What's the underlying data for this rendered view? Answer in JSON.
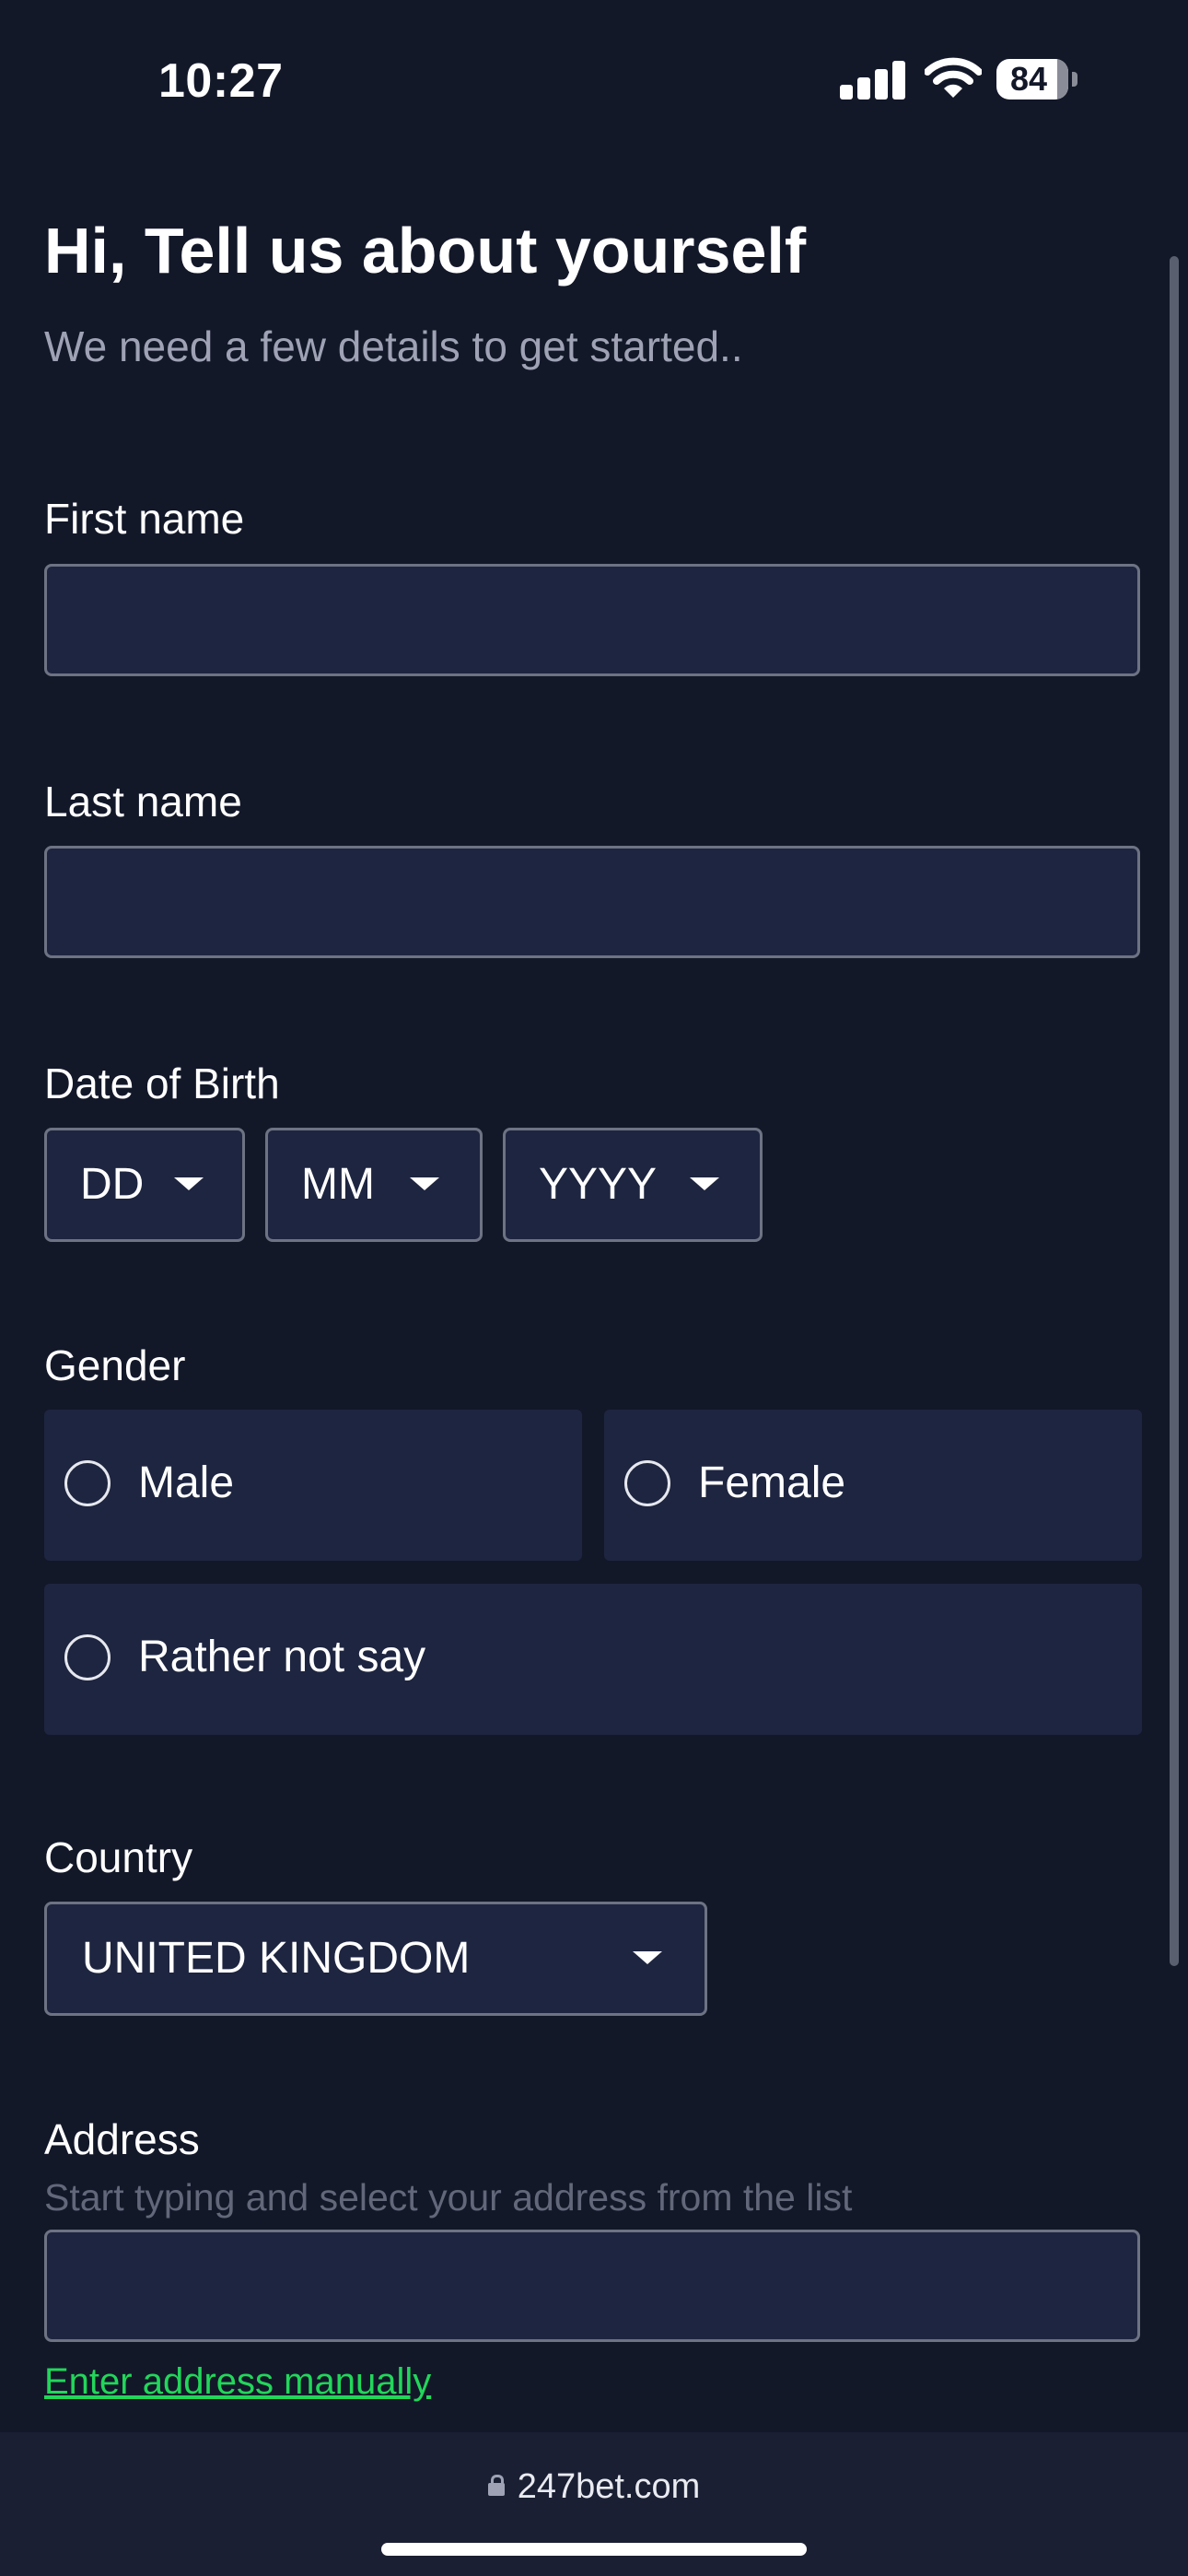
{
  "status_bar": {
    "time": "10:27",
    "battery": "84",
    "icons": [
      "cellular-signal-icon",
      "wifi-icon",
      "battery-icon"
    ]
  },
  "header": {
    "title": "Hi, Tell us about yourself",
    "subtitle": "We need a few details to get started.."
  },
  "form": {
    "first_name": {
      "label": "First name",
      "value": ""
    },
    "last_name": {
      "label": "Last name",
      "value": ""
    },
    "dob": {
      "label": "Date of Birth",
      "day": "DD",
      "month": "MM",
      "year": "YYYY"
    },
    "gender": {
      "label": "Gender",
      "options": [
        "Male",
        "Female",
        "Rather not say"
      ],
      "selected": null
    },
    "country": {
      "label": "Country",
      "value": "UNITED KINGDOM"
    },
    "address": {
      "label": "Address",
      "hint": "Start typing and select your address from the list",
      "value": "",
      "manual_link": "Enter address manually"
    }
  },
  "browser": {
    "url": "247bet.com"
  },
  "colors": {
    "background": "#131829",
    "field_background": "#1e2540",
    "field_border": "#6e7384",
    "link": "#22d65a",
    "subtle_text": "#9ea2b4"
  }
}
